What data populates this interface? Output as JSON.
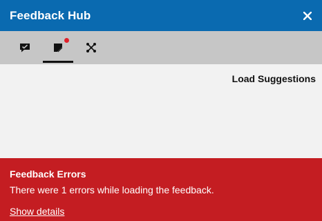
{
  "window": {
    "title": "Feedback Hub",
    "close_icon": "close-icon"
  },
  "toolbar": {
    "tabs": [
      {
        "icon": "feedback-chat-icon",
        "active": false
      },
      {
        "icon": "suggestions-icon",
        "active": true,
        "badge": true
      },
      {
        "icon": "network-nodes-icon",
        "active": false
      }
    ],
    "badge_color": "#e0202a"
  },
  "content": {
    "load_suggestions_label": "Load Suggestions"
  },
  "error": {
    "title": "Feedback Errors",
    "message": "There were 1 errors while loading the feedback.",
    "details_label": "Show details",
    "background": "#c41d22"
  },
  "colors": {
    "titlebar": "#0a6ab0",
    "toolbar": "#c6c6c6",
    "content_bg": "#f2f2f2"
  }
}
